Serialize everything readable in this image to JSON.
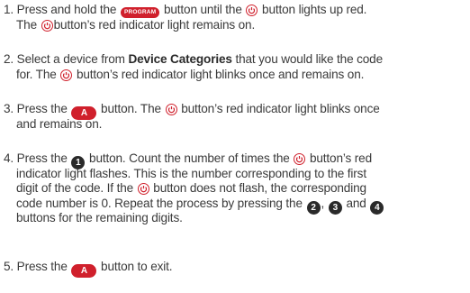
{
  "steps": {
    "s1": {
      "a": "1. Press and hold the",
      "program_label": "PROGRAM",
      "b": "button until the",
      "c": "button lights up red.",
      "d": "The",
      "e": "button’s red indicator light remains on."
    },
    "s2": {
      "a": "2. Select a device from",
      "bold": "Device Categories",
      "b": "that you would like the code",
      "c": "for. The",
      "d": "button’s red indicator light blinks once and remains on."
    },
    "s3": {
      "a": "3. Press the",
      "a_label": "A",
      "b": "button. The",
      "c": "button’s red indicator light blinks once",
      "d": "and remains on."
    },
    "s4": {
      "a": "4. Press the",
      "num1": "1",
      "b": "button. Count the number of times the",
      "c": "button’s red",
      "d": "indicator light flashes. This is the number corresponding to the first",
      "e": "digit of the code. If the",
      "f": "button does not flash, the corresponding",
      "g": "code number is 0. Repeat the process by pressing the",
      "num2": "2",
      "h": ",",
      "num3": "3",
      "i": "and",
      "num4": "4",
      "j": "buttons for the remaining digits."
    },
    "s5": {
      "a": "5. Press the",
      "a_label": "A",
      "b": "button to exit."
    }
  },
  "icons": {
    "power": "power-icon"
  },
  "colors": {
    "accent_red": "#d0202c",
    "text": "#3a3a3a",
    "badge_dark": "#2a2a2a"
  }
}
